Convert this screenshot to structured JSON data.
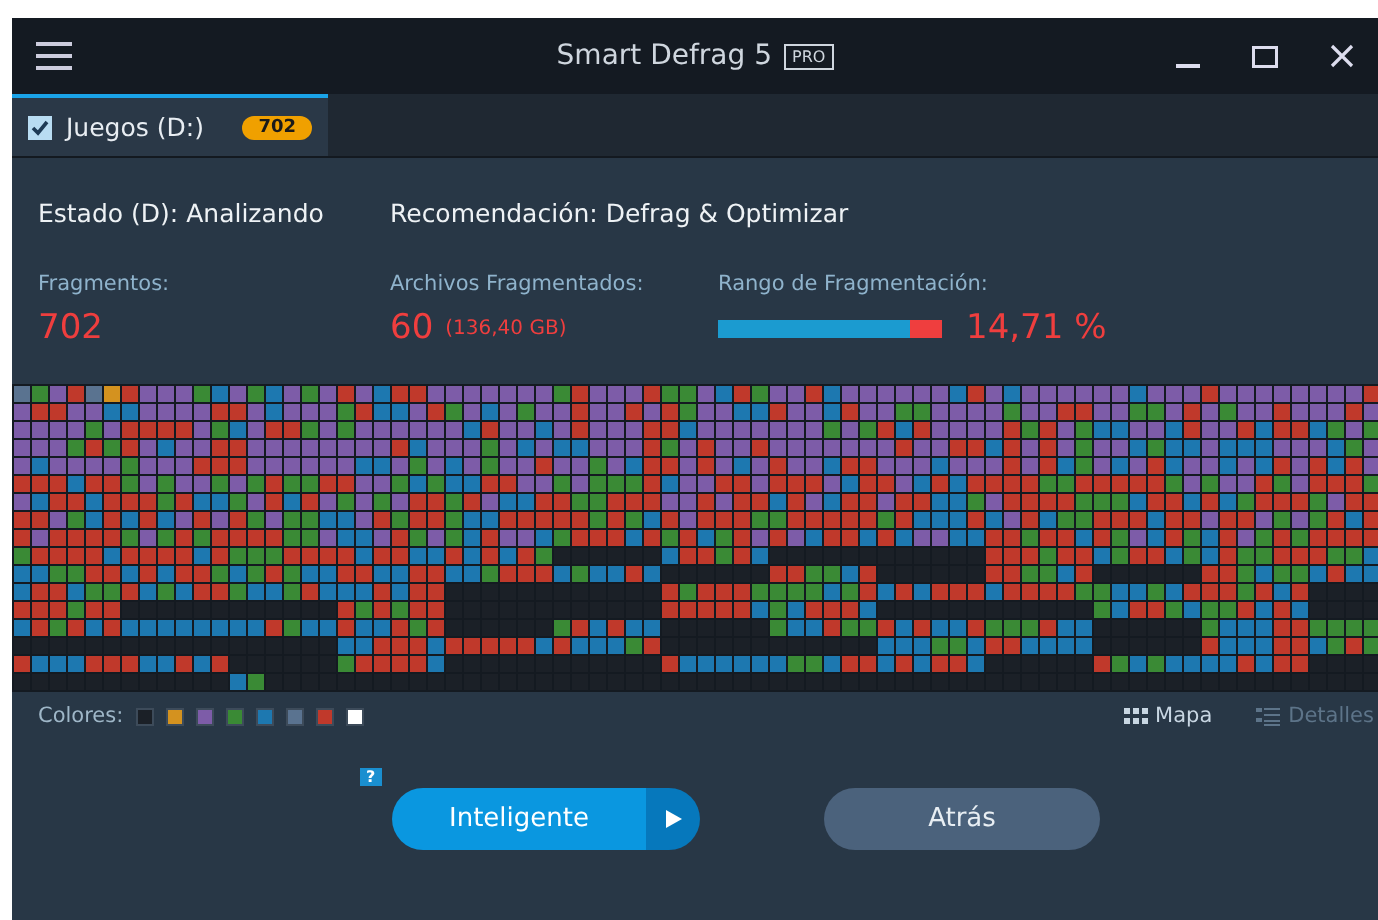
{
  "window": {
    "title": "Smart Defrag 5",
    "edition": "PRO"
  },
  "tabs": [
    {
      "label": "Juegos (D:)",
      "badge": "702",
      "checked": true,
      "selected": true
    }
  ],
  "status": {
    "state": "Estado (D): Analizando",
    "recommendation": "Recomendación: Defrag & Optimizar"
  },
  "stats": [
    {
      "kind": "number",
      "label": "Fragmentos:",
      "value": "702"
    },
    {
      "kind": "number",
      "label": "Archivos Fragmentados:",
      "value": "60",
      "note": "(136,40 GB)"
    },
    {
      "kind": "bar",
      "label": "Rango de Fragmentación:",
      "level": 0.1471,
      "value": "14,71 %"
    }
  ],
  "legend": {
    "label": "Colores:",
    "colors": [
      {
        "color": "#1b2027"
      },
      {
        "color": "#d4921f"
      },
      {
        "color": "#7d5ca8"
      },
      {
        "color": "#3a8a35"
      },
      {
        "color": "#1d78b0"
      },
      {
        "color": "#5a7390"
      },
      {
        "color": "#c0392b"
      },
      {
        "color": "#ffffff"
      }
    ]
  },
  "views": [
    {
      "label": "Mapa",
      "selected": true
    },
    {
      "label": "Detalles",
      "selected": false
    }
  ],
  "help": "?",
  "buttons": [
    {
      "kind": "primary",
      "label": "Inteligente"
    },
    {
      "kind": "secondary",
      "label": "Atrás"
    }
  ]
}
